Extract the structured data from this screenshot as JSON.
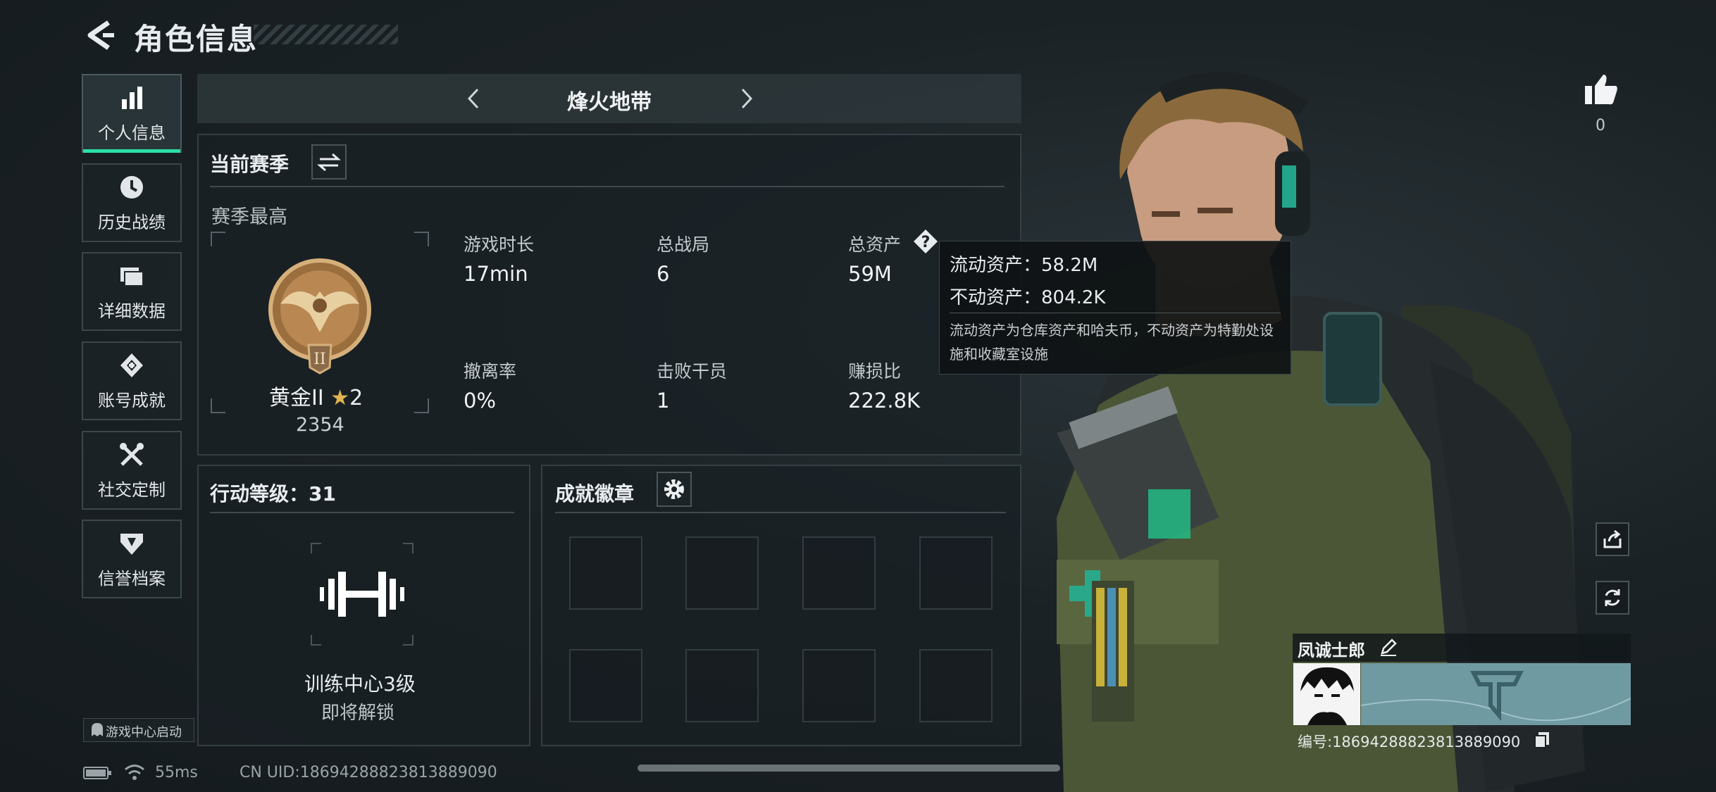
{
  "header": {
    "title": "角色信息"
  },
  "nav": {
    "items": [
      {
        "label": "个人信息",
        "icon": "bar-chart-icon",
        "active": true
      },
      {
        "label": "历史战绩",
        "icon": "clock-icon"
      },
      {
        "label": "详细数据",
        "icon": "folder-icon"
      },
      {
        "label": "账号成就",
        "icon": "medal-icon"
      },
      {
        "label": "社交定制",
        "icon": "tools-icon"
      },
      {
        "label": "信誉档案",
        "icon": "shield-icon"
      }
    ]
  },
  "mode_tab": {
    "label": "烽火地带"
  },
  "season": {
    "title": "当前赛季",
    "best_label": "赛季最高",
    "rank_name": "黄金II",
    "stars": "2",
    "rank_score": "2354",
    "stats": [
      {
        "label": "游戏时长",
        "value": "17min"
      },
      {
        "label": "总战局",
        "value": "6"
      },
      {
        "label": "总资产",
        "value": "59M"
      },
      {
        "label": "撤离率",
        "value": "0%"
      },
      {
        "label": "击败干员",
        "value": "1"
      },
      {
        "label": "赚损比",
        "value": "222.8K"
      }
    ]
  },
  "tooltip": {
    "liquid": "流动资产：58.2M",
    "fixed": "不动资产：804.2K",
    "desc_line1": "流动资产为仓库资产和哈夫币，不动资产为特勤处设",
    "desc_line2": "施和收藏室设施"
  },
  "action_level": {
    "title": "行动等级：31",
    "facility": "训练中心3级",
    "status": "即将解锁"
  },
  "achievements": {
    "title": "成就徽章"
  },
  "likes": {
    "count": "0"
  },
  "profile": {
    "name": "凤诚士郎",
    "id_text": "编号:18694288823813889090"
  },
  "bottom": {
    "game_center": "游戏中心启动",
    "ping": "55ms",
    "uid": "CN UID:18694288823813889090"
  },
  "colors": {
    "accent": "#29e0a6",
    "panel_border": "#343f44"
  }
}
